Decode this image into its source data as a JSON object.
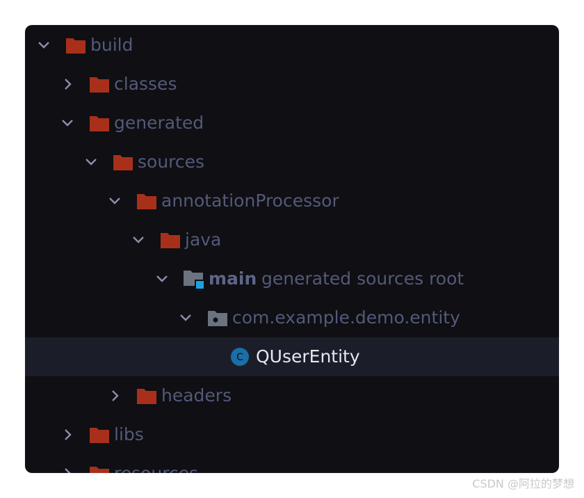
{
  "tree": {
    "nodes": [
      {
        "label": "build",
        "expanded": true,
        "icon": "folder-icon"
      },
      {
        "label": "classes",
        "expanded": false,
        "icon": "folder-icon"
      },
      {
        "label": "generated",
        "expanded": true,
        "icon": "folder-icon"
      },
      {
        "label": "sources",
        "expanded": true,
        "icon": "folder-icon"
      },
      {
        "label": "annotationProcessor",
        "expanded": true,
        "icon": "folder-icon"
      },
      {
        "label": "java",
        "expanded": true,
        "icon": "folder-icon"
      },
      {
        "label": "main",
        "hint": "generated sources root",
        "expanded": true,
        "icon": "source-root-folder-icon"
      },
      {
        "label": "com.example.demo.entity",
        "expanded": true,
        "icon": "package-icon"
      },
      {
        "label": "QUserEntity",
        "selected": true,
        "icon": "class-icon",
        "icon_letter": "C"
      },
      {
        "label": "headers",
        "expanded": false,
        "icon": "folder-icon"
      },
      {
        "label": "libs",
        "expanded": false,
        "icon": "folder-icon"
      },
      {
        "label": "resources",
        "expanded": false,
        "icon": "folder-icon"
      }
    ]
  },
  "watermark": "CSDN @阿拉的梦想",
  "colors": {
    "background": "#0f0f14",
    "folder": "#a8301a",
    "package": "#6b7280",
    "class_icon": "#1a6fa8",
    "source_root_accent": "#1ba3e0",
    "selected_row": "#1b1e29",
    "text": "#535a78",
    "selected_text": "#e6e8ef"
  }
}
